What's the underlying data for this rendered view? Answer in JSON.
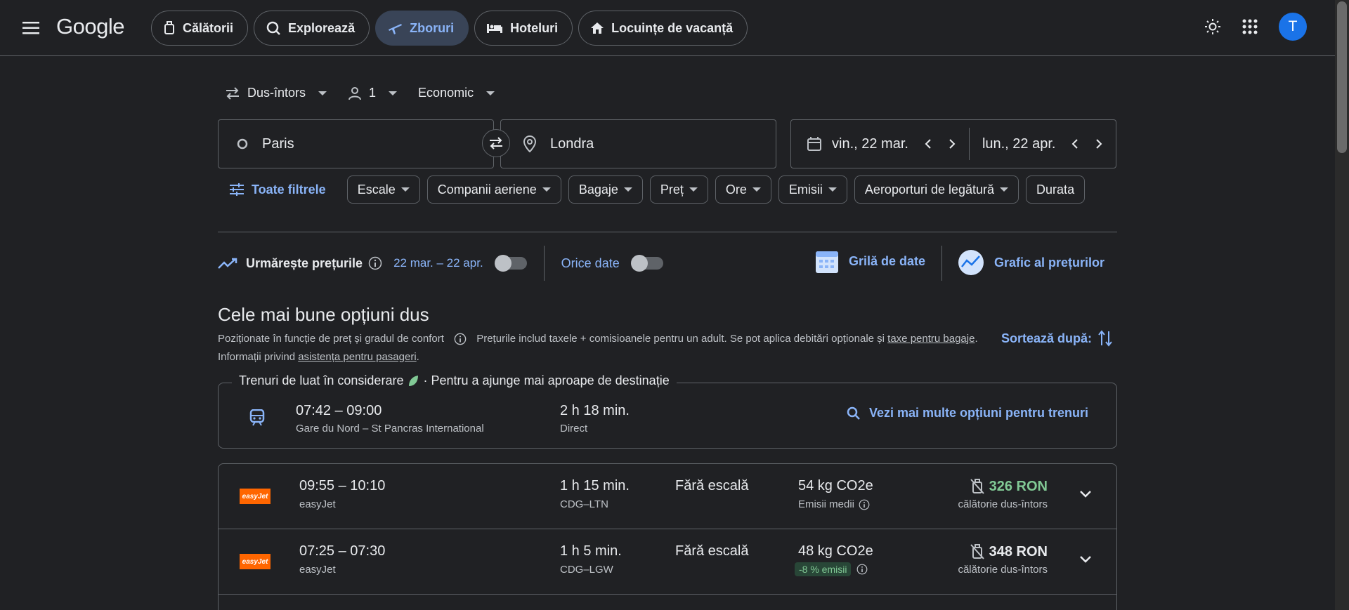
{
  "header": {
    "logo": "Google",
    "nav": [
      {
        "label": "Călătorii",
        "icon": "suitcase-icon"
      },
      {
        "label": "Explorează",
        "icon": "explore-icon"
      },
      {
        "label": "Zboruri",
        "icon": "plane-icon",
        "active": true
      },
      {
        "label": "Hoteluri",
        "icon": "bed-icon"
      },
      {
        "label": "Locuințe de vacanță",
        "icon": "house-icon"
      }
    ],
    "avatar_letter": "T",
    "accent_color": "#8ab4f8"
  },
  "search": {
    "trip_type": "Dus-întors",
    "passengers": "1",
    "cabin": "Economic",
    "origin": "Paris",
    "destination": "Londra",
    "depart_date": "vin., 22 mar.",
    "return_date": "lun., 22 apr."
  },
  "filters": {
    "all_label": "Toate filtrele",
    "chips": [
      "Escale",
      "Companii aeriene",
      "Bagaje",
      "Preț",
      "Ore",
      "Emisii",
      "Aeroporturi de legătură",
      "Durata"
    ]
  },
  "tracker": {
    "label": "Urmărește prețurile",
    "date_range": "22 mar. – 22 apr.",
    "any_dates": "Orice date",
    "date_grid": "Grilă de date",
    "price_graph": "Grafic al prețurilor"
  },
  "results": {
    "title": "Cele mai bune opțiuni dus",
    "subtitle_a": "Poziționate în funcție de preț și gradul de confort",
    "subtitle_b": "Prețurile includ taxele + comisioanele pentru un adult. Se pot aplica debitări opționale și",
    "link_fees": "taxe pentru bagaje",
    "subtitle_c": ". Informații privind",
    "link_assist": "asistența pentru pasageri",
    "subtitle_d": ".",
    "sort_label": "Sortează după:"
  },
  "train": {
    "legend": "Trenuri de luat în considerare",
    "legend_sub": "· Pentru a ajunge mai aproape de destinație",
    "times": "07:42 – 09:00",
    "stations": "Gare du Nord – St Pancras International",
    "duration": "2 h 18 min.",
    "type": "Direct",
    "more": "Vezi mai multe opțiuni pentru trenuri"
  },
  "flights": [
    {
      "airline_logo": "easyJet",
      "times": "09:55 – 10:10",
      "airline": "easyJet",
      "duration": "1 h 15 min.",
      "route": "CDG–LTN",
      "stops": "Fără escală",
      "emissions": "54 kg CO2e",
      "emissions_note": "Emisii medii",
      "price": "326 RON",
      "price_note": "călătorie dus-întors",
      "price_color": "#81c995"
    },
    {
      "airline_logo": "easyJet",
      "times": "07:25 – 07:30",
      "airline": "easyJet",
      "duration": "1 h 5 min.",
      "route": "CDG–LGW",
      "stops": "Fără escală",
      "emissions": "48 kg CO2e",
      "emissions_note": "-8 % emisii",
      "price": "348 RON",
      "price_note": "călătorie dus-întors",
      "price_color": "#e8eaed"
    }
  ]
}
